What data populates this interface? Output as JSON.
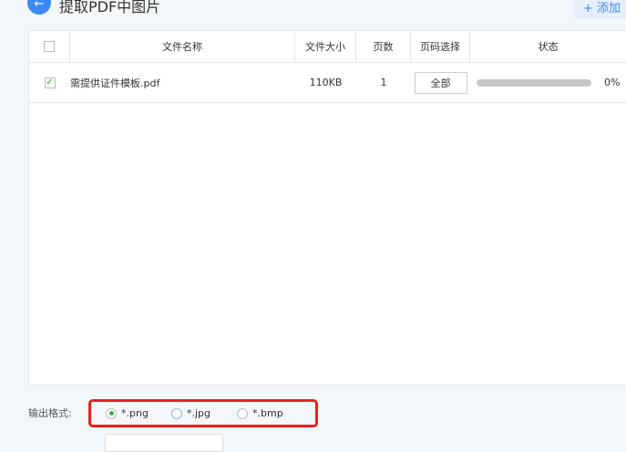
{
  "header": {
    "back_icon": "arrow-left-icon",
    "title": "提取PDF中图片",
    "add_label": "+ 添加"
  },
  "table": {
    "columns": [
      "文件名称",
      "文件大小",
      "页数",
      "页码选择",
      "状态"
    ],
    "rows": [
      {
        "checked": true,
        "name": "需提供证件模板.pdf",
        "size": "110KB",
        "pages": "1",
        "page_select": "全部",
        "progress": 0,
        "status": "0%"
      }
    ]
  },
  "output": {
    "label": "输出格式:",
    "options": [
      {
        "label": "*.png",
        "selected": true
      },
      {
        "label": "*.jpg",
        "selected": false
      },
      {
        "label": "*.bmp",
        "selected": false
      }
    ]
  },
  "colors": {
    "accent": "#3d8af7",
    "highlight": "#f01c1c"
  }
}
